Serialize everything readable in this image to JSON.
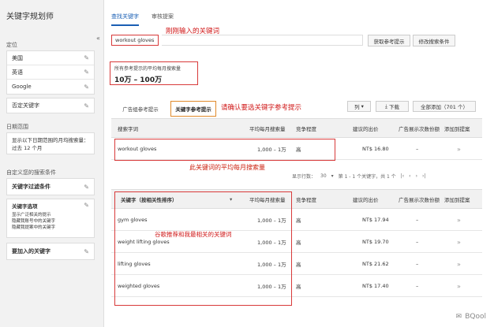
{
  "sidebar": {
    "title": "关键字规划师",
    "targeting_label": "定位",
    "targeting": [
      "美国",
      "英语",
      "Google",
      "否定关键字"
    ],
    "date_label": "日期范围",
    "date_range": "显示以下日期范围的月均搜索量：过去 12 个月",
    "search_label": "自定义您的搜索条件",
    "filters": {
      "keyword_filters": "关键字过滤条件",
      "keyword_options": "关键字选项",
      "options_lines": [
        "显示广泛相关的提示",
        "隐藏我账号中的关键字",
        "隐藏我提案中的关键字"
      ],
      "include_keywords": "要加入的关键字"
    }
  },
  "tabs": {
    "active": "查找关键字",
    "idle": "审核提案"
  },
  "search": {
    "keyword": "workout gloves",
    "btn_get_ideas": "获取参考提示",
    "btn_modify": "修改搜索条件"
  },
  "volume": {
    "label": "所有参考提示的平均每月搜索量",
    "value": "10万 – 100万"
  },
  "mid_tabs": {
    "group_ideas": "广告组参考提示",
    "keyword_ideas": "关键字参考提示"
  },
  "toolbar": {
    "columns": "列",
    "download": "下载",
    "add_all": "全部添加（701 个）"
  },
  "table1": {
    "headers": [
      "搜索字词",
      "平均每月搜索量",
      "竞争程度",
      "建议的出价",
      "广告展示次数份额",
      "添加到提案"
    ],
    "rows": [
      {
        "term": "workout gloves",
        "volume": "1,000 – 1万",
        "competition": "高",
        "bid": "NT$ 16.80",
        "share": "–"
      }
    ]
  },
  "pager": {
    "rows_label": "显示行数：",
    "rows": "30",
    "range": "第 1 - 1 个关键字，共 1 个"
  },
  "table2": {
    "headers": [
      "关键字（按相关性排序）",
      "平均每月搜索量",
      "竞争程度",
      "建议的出价",
      "广告展示次数份额",
      "添加到提案"
    ],
    "rows": [
      {
        "term": "gym gloves",
        "volume": "1,000 – 1万",
        "competition": "高",
        "bid": "NT$ 17.94",
        "share": "–"
      },
      {
        "term": "weight lifting gloves",
        "volume": "1,000 – 1万",
        "competition": "高",
        "bid": "NT$ 19.70",
        "share": "–"
      },
      {
        "term": "lifting gloves",
        "volume": "1,000 – 1万",
        "competition": "高",
        "bid": "NT$ 21.62",
        "share": "–"
      },
      {
        "term": "weighted gloves",
        "volume": "1,000 – 1万",
        "competition": "高",
        "bid": "NT$ 17.40",
        "share": "–"
      }
    ]
  },
  "annotations": {
    "a1": "刚刚输入的关键词",
    "a2": "请确认要选关键字参考提示",
    "a3": "此关键词的平均每月搜索量",
    "a4": "谷歌推荐和我最相关的关键词"
  },
  "watermark": "BQool",
  "colors": {
    "accent": "#1a5fb4",
    "annotation": "#d01818"
  }
}
